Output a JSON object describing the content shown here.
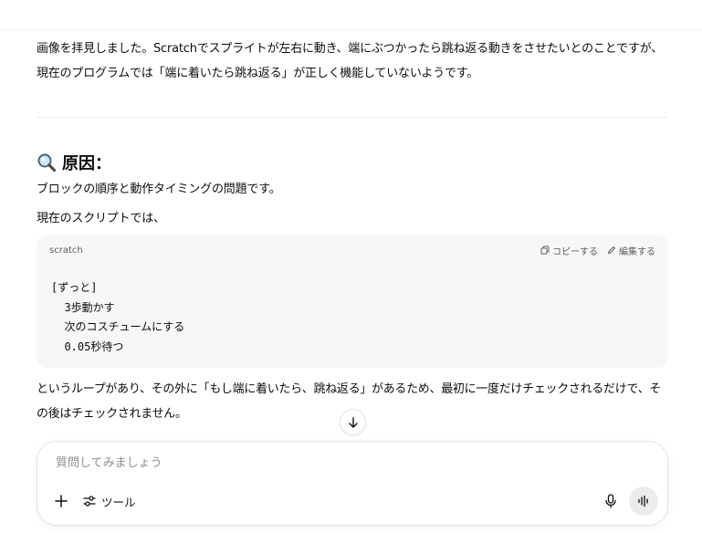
{
  "message": {
    "intro": "画像を拝見しました。Scratchでスプライトが左右に動き、端にぶつかったら跳ね返る動きをさせたいとのことですが、現在のプログラムでは「端に着いたら跳ね返る」が正しく機能していないようです。",
    "heading": "原因：",
    "heading_icon": "magnifier-icon",
    "cause": "ブロックの順序と動作タイミングの問題です。",
    "current": "現在のスクリプトでは、",
    "after": "というループがあり、その外に「もし端に着いたら、跳ね返る」があるため、最初に一度だけチェックされるだけで、その後はチェックされません。"
  },
  "code_block": {
    "language": "scratch",
    "copy_label": "コピーする",
    "edit_label": "編集する",
    "lines": [
      "[ずっと]",
      "  3歩動かす",
      "  次のコスチュームにする",
      "  0.05秒待つ"
    ]
  },
  "composer": {
    "placeholder": "質問してみましょう",
    "tools_label": "ツール"
  },
  "colors": {
    "code_bg": "#f7f7f7",
    "divider": "#ececec",
    "voice_bg": "#ececec"
  }
}
